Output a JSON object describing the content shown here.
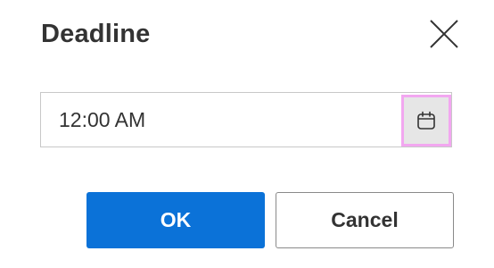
{
  "dialog": {
    "title": "Deadline",
    "close_icon": "close-icon"
  },
  "deadline_field": {
    "value": "12:00 AM",
    "calendar_icon": "calendar-icon"
  },
  "buttons": {
    "ok_label": "OK",
    "cancel_label": "Cancel"
  },
  "colors": {
    "primary": "#0b72d8",
    "focus_outline": "#f2a7f0",
    "text": "#333333"
  }
}
